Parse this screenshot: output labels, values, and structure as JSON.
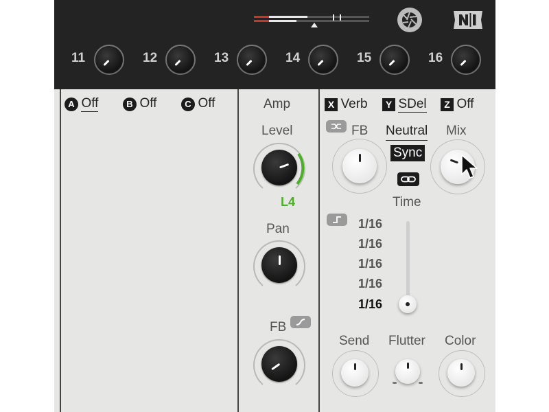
{
  "header": {
    "macros": [
      {
        "label": "11"
      },
      {
        "label": "12"
      },
      {
        "label": "13"
      },
      {
        "label": "14"
      },
      {
        "label": "15"
      },
      {
        "label": "16"
      }
    ]
  },
  "fx_slots": {
    "a": {
      "letter": "A",
      "value": "Off"
    },
    "b": {
      "letter": "B",
      "value": "Off"
    },
    "c": {
      "letter": "C",
      "value": "Off"
    }
  },
  "amp": {
    "title": "Amp",
    "level_label": "Level",
    "level_value": "L4",
    "level_color": "#4caf28",
    "pan_label": "Pan",
    "fb_label": "FB"
  },
  "fx_assign": {
    "x": {
      "letter": "X",
      "value": "Verb"
    },
    "y": {
      "letter": "Y",
      "value": "SDel"
    },
    "z": {
      "letter": "Z",
      "value": "Off"
    }
  },
  "delay": {
    "fb_label": "FB",
    "mode": "Neutral",
    "sync_label": "Sync",
    "mix_label": "Mix",
    "time_label": "Time",
    "time_steps": [
      "1/16",
      "1/16",
      "1/16",
      "1/16",
      "1/16"
    ],
    "send_label": "Send",
    "flutter_label": "Flutter",
    "color_label": "Color"
  }
}
